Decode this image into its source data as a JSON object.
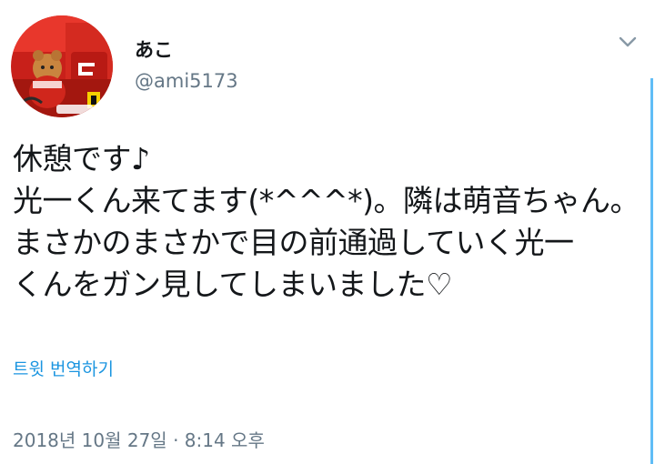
{
  "author": {
    "display_name": "あこ",
    "handle": "@ami5173"
  },
  "tweet": {
    "text": "休憩です♪\n光一くん来てます(*^^^*)。隣は萌音ちゃん。\nまさかのまさかで目の前通過していく光一\nくんをガン見してしまいました♡",
    "translate_label": "트윗 번역하기",
    "timestamp": "2018년 10월 27일 · 8:14 오후"
  },
  "icons": {
    "menu": "chevron-down-icon"
  },
  "colors": {
    "link": "#1b95e0",
    "secondary_text": "#657786",
    "primary_text": "#14171a"
  }
}
